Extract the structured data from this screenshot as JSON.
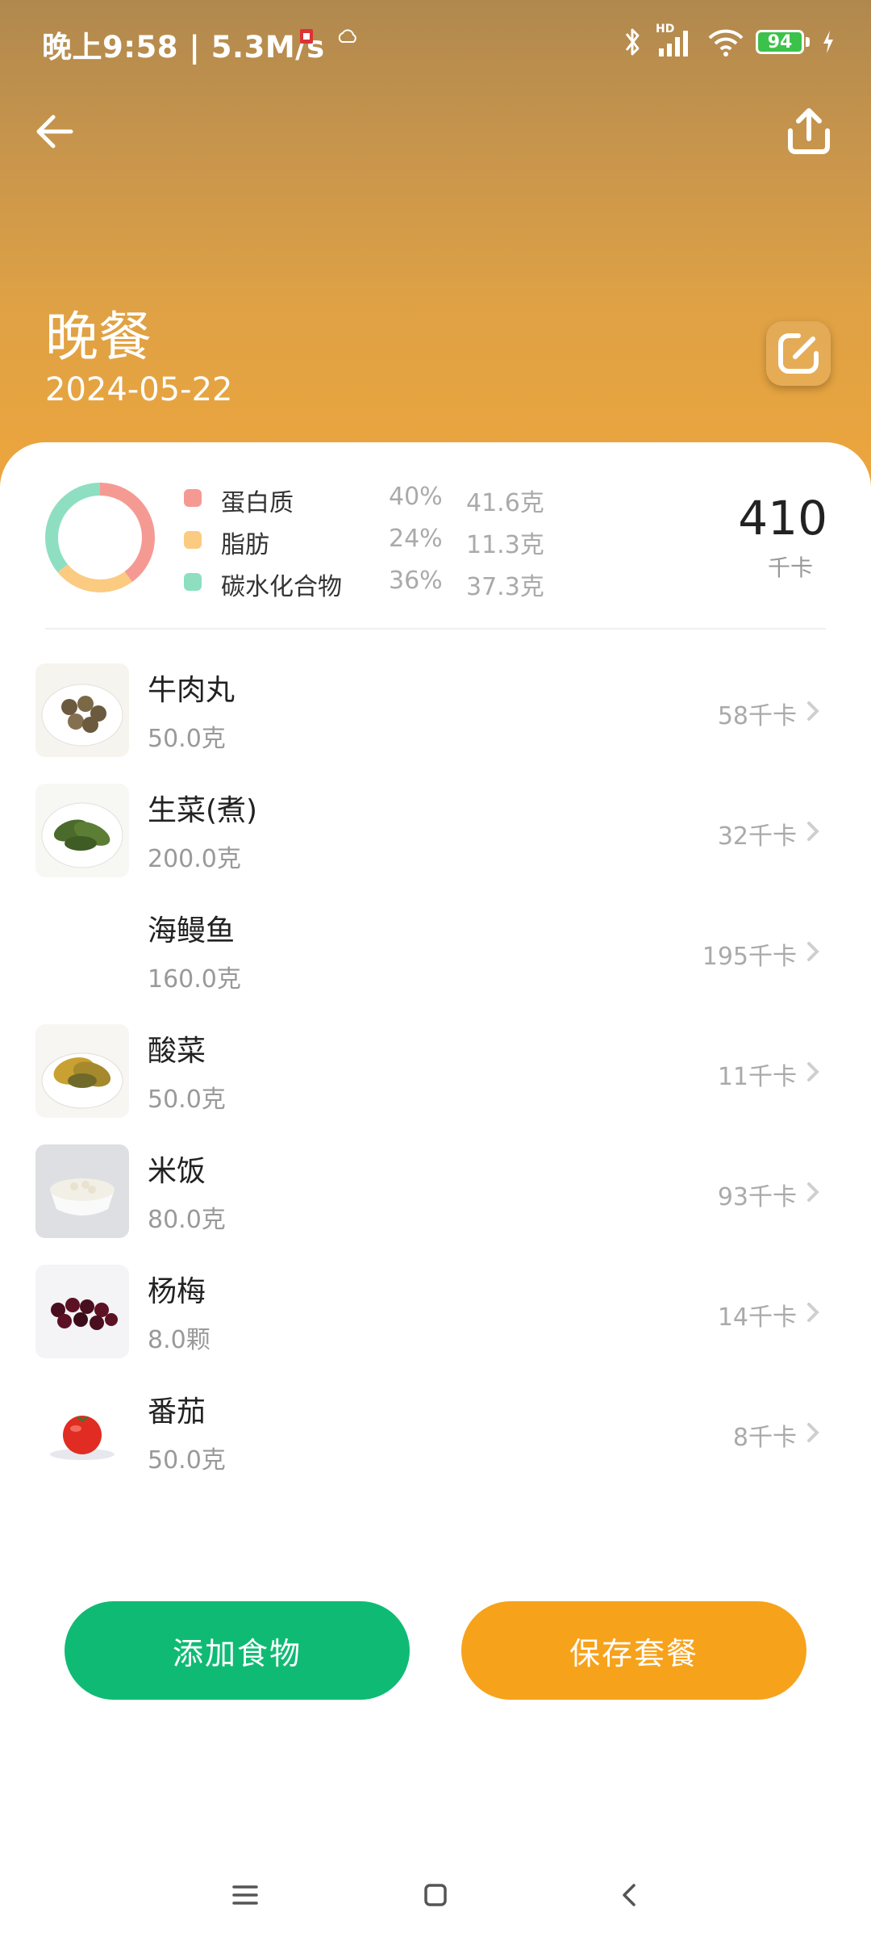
{
  "status_bar": {
    "time": "晚上9:58 | 5.3M/s",
    "network": "HD",
    "battery": "94",
    "icons": [
      "app-notification-icon",
      "cloud-icon",
      "bluetooth-icon",
      "signal-icon",
      "wifi-icon",
      "battery-icon",
      "charging-icon"
    ]
  },
  "header": {
    "meal_name": "晚餐",
    "date": "2024-05-22",
    "icons": [
      "back-arrow-icon",
      "share-icon",
      "edit-icon"
    ]
  },
  "nutrition": {
    "total_kcal": "410",
    "kcal_unit": "千卡",
    "macros": [
      {
        "name": "蛋白质",
        "pct": "40%",
        "amount": "41.6克",
        "color": "#f59a93",
        "fraction": 0.4
      },
      {
        "name": "脂肪",
        "pct": "24%",
        "amount": "11.3克",
        "color": "#fbcb82",
        "fraction": 0.24
      },
      {
        "name": "碳水化合物",
        "pct": "36%",
        "amount": "37.3克",
        "color": "#8edfc2",
        "fraction": 0.36
      }
    ]
  },
  "foods": [
    {
      "name": "牛肉丸",
      "amount": "50.0克",
      "kcal": "58千卡",
      "thumb": "beef-meatballs"
    },
    {
      "name": "生菜(煮)",
      "amount": "200.0克",
      "kcal": "32千卡",
      "thumb": "boiled-lettuce"
    },
    {
      "name": "海鳗鱼",
      "amount": "160.0克",
      "kcal": "195千卡",
      "thumb": "none"
    },
    {
      "name": "酸菜",
      "amount": "50.0克",
      "kcal": "11千卡",
      "thumb": "pickled-cabbage"
    },
    {
      "name": "米饭",
      "amount": "80.0克",
      "kcal": "93千卡",
      "thumb": "rice-bowl"
    },
    {
      "name": "杨梅",
      "amount": "8.0颗",
      "kcal": "14千卡",
      "thumb": "bayberries"
    },
    {
      "name": "番茄",
      "amount": "50.0克",
      "kcal": "8千卡",
      "thumb": "tomato"
    }
  ],
  "buttons": {
    "add_food": "添加食物",
    "save_meal": "保存套餐"
  },
  "colors": {
    "add_button": "#0fbb74",
    "save_button": "#f7a21b",
    "header_top": "#b0884e",
    "header_bottom": "#eea63c"
  },
  "nav_bar": {
    "icons": [
      "menu-icon",
      "home-icon",
      "back-icon"
    ]
  }
}
